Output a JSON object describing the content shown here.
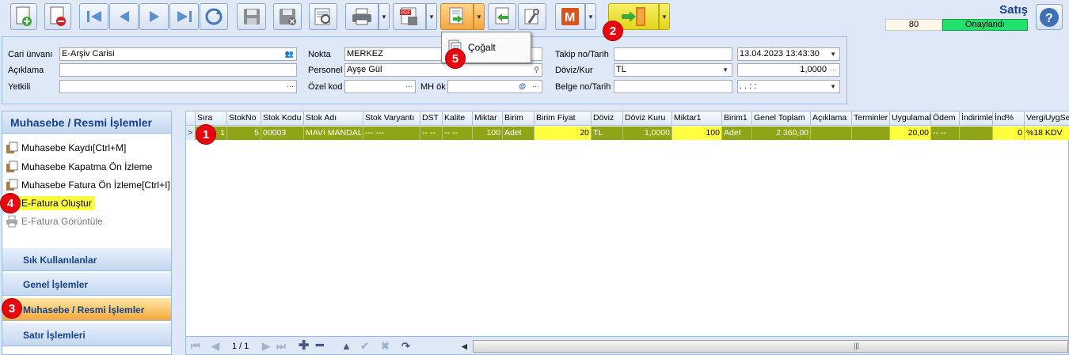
{
  "header": {
    "title": "Satış",
    "count": "80",
    "status": "Onaylandı"
  },
  "popup_menu": {
    "item": "Çoğalt"
  },
  "form": {
    "cari_unvani_label": "Cari ünvanı",
    "cari_unvani_value": "E-Arşiv Carisi",
    "aciklama_label": "Açıklama",
    "yetkili_label": "Yetkili",
    "nokta_label": "Nokta",
    "nokta_value": "MERKEZ",
    "personel_label": "Personel",
    "personel_value": "Ayşe Gül",
    "ozel_kod_label": "Özel kod",
    "mh_ok_label": "MH ök",
    "takip_label": "Takip no/Tarih",
    "takip_date": "13.04.2023 13:43:30",
    "doviz_label": "Döviz/Kur",
    "doviz_value": "TL",
    "kur_value": "1,0000",
    "belge_label": "Belge no/Tarih",
    "belge_date": ".  .      :  :"
  },
  "left_panel": {
    "header": "Muhasebe / Resmi İşlemler",
    "items": [
      {
        "label": "Muhasebe Kaydı[Ctrl+M]"
      },
      {
        "label": "Muhasebe Kapatma Ön İzleme"
      },
      {
        "label": "Muhasebe Fatura Ön İzleme[Ctrl+I]"
      },
      {
        "label": "E-Fatura Oluştur"
      },
      {
        "label": "E-Fatura Görüntüle"
      }
    ],
    "groups": [
      {
        "label": "Sık Kullanılanlar"
      },
      {
        "label": "Genel İşlemler"
      },
      {
        "label": "Muhasebe / Resmi İşlemler"
      },
      {
        "label": "Satır İşlemleri"
      }
    ]
  },
  "grid": {
    "columns": [
      "Sıra",
      "StokNo",
      "Stok Kodu",
      "Stok Adı",
      "Stok Varyantı",
      "DST",
      "Kalite",
      "Miktar",
      "Birim",
      "Birim Fiyat",
      "Döviz",
      "Döviz Kuru",
      "Miktar1",
      "Birim1",
      "Genel Toplam",
      "Açıklama",
      "Terminler",
      "Uygulamal",
      "Ödem",
      "İndirimle",
      "İnd%",
      "VergiUygSeti"
    ],
    "row": [
      "1",
      "5",
      "00003",
      "MAVİ MANDAL",
      "--- ---",
      "-- --",
      "-- --",
      "100",
      "Adet",
      "20",
      "TL",
      "1,0000",
      "100",
      "Adet",
      "2.360,00",
      "",
      "",
      "20,00",
      "-- --",
      "",
      "0",
      "%18 KDV"
    ],
    "pager": "1 / 1"
  },
  "badges": [
    "1",
    "2",
    "3",
    "4",
    "5"
  ],
  "colors": {
    "selected_row": "#8fa516",
    "highlight_yellow": "#ffff40",
    "status_green": "#21e06c",
    "badge_red": "#e8060e"
  }
}
